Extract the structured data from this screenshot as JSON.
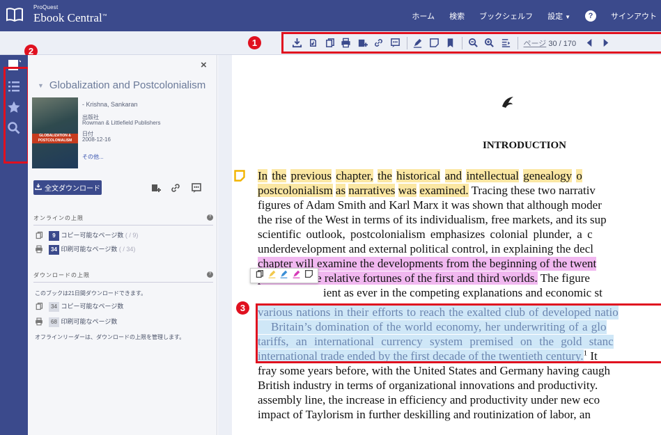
{
  "header": {
    "logo_small": "ProQuest",
    "logo_main": "Ebook Central",
    "logo_tm": "™",
    "nav": {
      "home": "ホーム",
      "search": "検索",
      "bookshelf": "ブックシェルフ",
      "settings": "設定",
      "signout": "サインアウト"
    }
  },
  "toolbar": {
    "page_label": "ページ",
    "page_value": "30 / 170"
  },
  "badges": {
    "one": "1",
    "two": "2",
    "three": "3"
  },
  "sidebar": {
    "close": "×",
    "book_title": "Globalization and Postcolonialism",
    "author": "- Krishna, Sankaran",
    "publisher_label": "出版社",
    "publisher": "Rowman & Littlefield Publishers",
    "date_label": "日付",
    "date": "2008-12-16",
    "more": "その他...",
    "cover_text": "GLOBALIZATION & POSTCOLONIALISM",
    "download_full": "全文ダウンロード",
    "online_limit": {
      "title": "オンラインの上限",
      "copy_count": "9",
      "copy_label": "コピー可能なページ数",
      "copy_total": "( / 9)",
      "print_count": "34",
      "print_label": "印刷可能なページ数",
      "print_total": "( / 34)"
    },
    "download_limit": {
      "title": "ダウンロードの上限",
      "note": "このブックは21日間ダウンロードできます。",
      "copy_count": "34",
      "copy_label": "コピー可能なページ数",
      "print_count": "68",
      "print_label": "印刷可能なページ数",
      "footer": "オフラインリーダーは、ダウンロードの上限を管理します。"
    }
  },
  "document": {
    "heading": "INTRODUCTION",
    "l1": {
      "s1": "In",
      "s2": "the",
      "s3": "previous",
      "s4": "chapter,",
      "s5": "the",
      "s6": "historical",
      "s7": "and",
      "s8": "intellectual",
      "s9": "genealogy",
      "s10": "o"
    },
    "l2": {
      "s1": "postcolonialism",
      "s2": "as",
      "s3": "narratives",
      "s4": "was",
      "s5": "examined.",
      "s6": "Tracing these two narrativ"
    },
    "l3": "figures of Adam Smith and Karl Marx it was shown that although moder",
    "l4": "the rise of the West in terms of its individualism, free markets, and its sup",
    "l5": "scientific outlook, postcolonialism emphasizes colonial plunder, a c",
    "l6": "underdevelopment and external political control, in explaining the decl",
    "l7": "chapter will examine the developments from the beginning of the twent",
    "l8": {
      "hl": "present in the relative fortunes of the first and third worlds.",
      "rest": " The figure"
    },
    "l9": "ient as ever in the competing explanations and economic st",
    "l10": "various nations in their efforts to reach the exalted club of developed natio",
    "l11": "Britain’s domination of the world economy, her underwriting of a glo",
    "l12": "tariffs, an international currency system premised on the gold stanc",
    "l13": {
      "hl": "international trade ended by the first decade of the twentieth century.",
      "sup": "1",
      "rest": " It"
    },
    "l14": "fray some years before, with the United States and Germany having caugh",
    "l15": "British industry in terms of organizational innovations and productivity.",
    "l16": "assembly line, the increase in efficiency and productivity under new eco",
    "l17": "impact of Taylorism in further deskilling and routinization of labor, an"
  }
}
